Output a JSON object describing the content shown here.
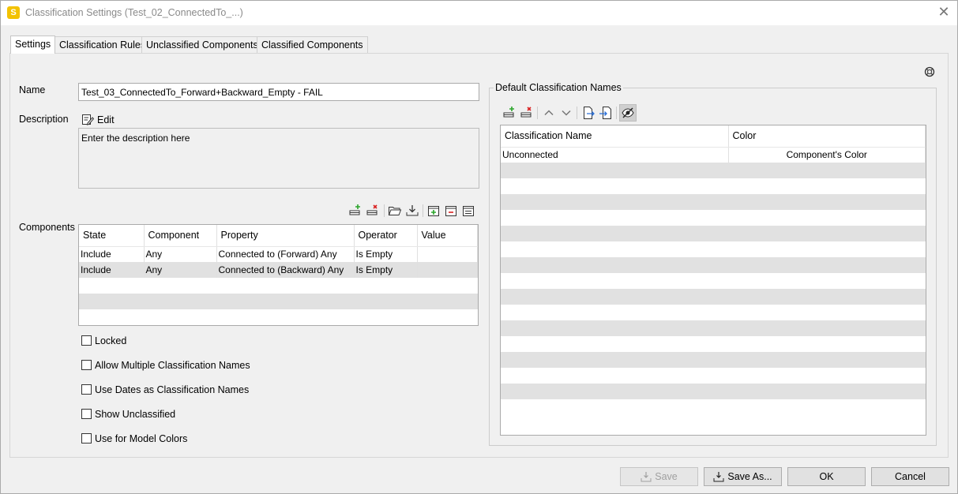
{
  "window": {
    "title": "Classification Settings (Test_02_ConnectedTo_...)",
    "app_icon_letter": "S"
  },
  "tabs": [
    {
      "label": "Settings",
      "active": true
    },
    {
      "label": "Classification Rules",
      "active": false
    },
    {
      "label": "Unclassified Components",
      "active": false
    },
    {
      "label": "Classified Components",
      "active": false
    }
  ],
  "settings": {
    "name_label": "Name",
    "name_value": "Test_03_ConnectedTo_Forward+Backward_Empty -  FAIL",
    "description_label": "Description",
    "edit_label": "Edit",
    "description_value": "Enter the description here",
    "components_label": "Components"
  },
  "components_table": {
    "headers": [
      "State",
      "Component",
      "Property",
      "Operator",
      "Value"
    ],
    "rows": [
      [
        "Include",
        "Any",
        "Connected to (Forward) Any",
        "Is Empty",
        ""
      ],
      [
        "Include",
        "Any",
        "Connected to (Backward) Any",
        "Is Empty",
        ""
      ]
    ]
  },
  "checkboxes": [
    {
      "label": "Locked",
      "checked": false
    },
    {
      "label": "Allow Multiple Classification Names",
      "checked": false
    },
    {
      "label": "Use Dates as Classification Names",
      "checked": false
    },
    {
      "label": "Show Unclassified",
      "checked": false
    },
    {
      "label": "Use for Model Colors",
      "checked": false
    }
  ],
  "default_names": {
    "group_title": "Default Classification Names",
    "headers": [
      "Classification Name",
      "Color"
    ],
    "rows": [
      [
        "Unconnected",
        "Component's Color"
      ]
    ]
  },
  "buttons": {
    "save": "Save",
    "save_as": "Save As...",
    "ok": "OK",
    "cancel": "Cancel"
  },
  "colors": {
    "app_icon": "#f3c200",
    "add_icon": "#2aa52a",
    "remove_icon": "#d92020",
    "import_icon": "#2a6fd6"
  }
}
